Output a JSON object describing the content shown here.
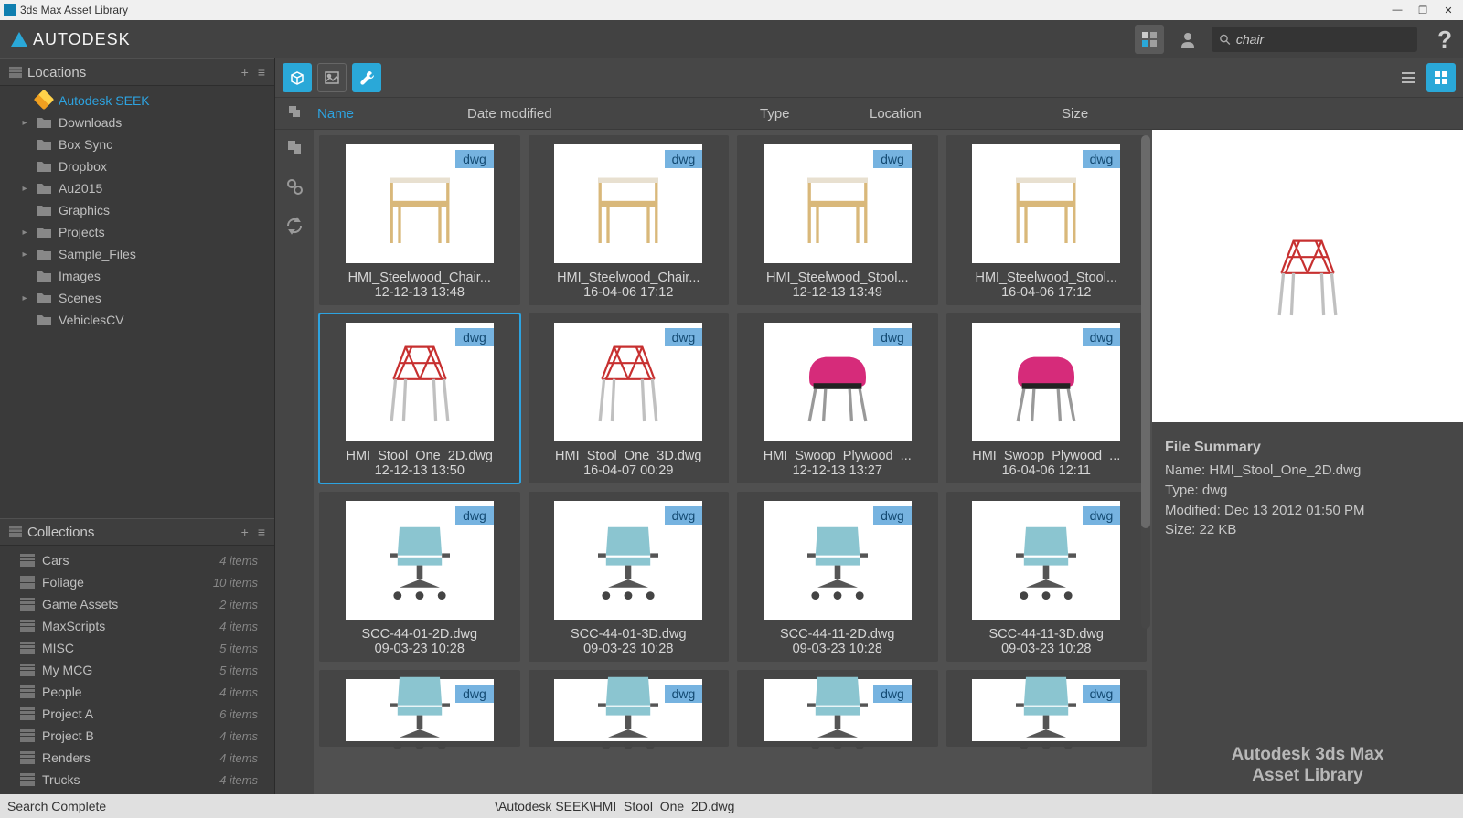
{
  "window": {
    "title": "3ds Max Asset Library"
  },
  "header": {
    "logo_text": "AUTODESK",
    "search_value": "chair"
  },
  "sidebar": {
    "locations": {
      "title": "Locations",
      "add_label": "+",
      "items": [
        {
          "label": "Autodesk SEEK",
          "expand": "",
          "icon": "seek",
          "active": true
        },
        {
          "label": "Downloads",
          "expand": "▸",
          "icon": "folder"
        },
        {
          "label": "Box Sync",
          "expand": "",
          "icon": "folder"
        },
        {
          "label": "Dropbox",
          "expand": "",
          "icon": "folder"
        },
        {
          "label": "Au2015",
          "expand": "▸",
          "icon": "folder"
        },
        {
          "label": "Graphics",
          "expand": "",
          "icon": "folder"
        },
        {
          "label": "Projects",
          "expand": "▸",
          "icon": "folder"
        },
        {
          "label": "Sample_Files",
          "expand": "▸",
          "icon": "folder"
        },
        {
          "label": "Images",
          "expand": "",
          "icon": "folder"
        },
        {
          "label": "Scenes",
          "expand": "▸",
          "icon": "folder"
        },
        {
          "label": "VehiclesCV",
          "expand": "",
          "icon": "folder"
        }
      ]
    },
    "collections": {
      "title": "Collections",
      "items": [
        {
          "label": "Cars",
          "count": "4 items"
        },
        {
          "label": "Foliage",
          "count": "10 items"
        },
        {
          "label": "Game Assets",
          "count": "2 items"
        },
        {
          "label": "MaxScripts",
          "count": "4 items"
        },
        {
          "label": "MISC",
          "count": "5 items"
        },
        {
          "label": "My MCG",
          "count": "5 items"
        },
        {
          "label": "People",
          "count": "4 items"
        },
        {
          "label": "Project A",
          "count": "6 items"
        },
        {
          "label": "Project B",
          "count": "4 items"
        },
        {
          "label": "Renders",
          "count": "4 items"
        },
        {
          "label": "Trucks",
          "count": "4 items"
        }
      ]
    }
  },
  "columns": {
    "name": "Name",
    "date": "Date modified",
    "type": "Type",
    "location": "Location",
    "size": "Size"
  },
  "assets": [
    {
      "name": "HMI_Steelwood_Chair...",
      "date": "12-12-13 13:48",
      "badge": "dwg",
      "style": "wood"
    },
    {
      "name": "HMI_Steelwood_Chair...",
      "date": "16-04-06 17:12",
      "badge": "dwg",
      "style": "wood"
    },
    {
      "name": "HMI_Steelwood_Stool...",
      "date": "12-12-13 13:49",
      "badge": "dwg",
      "style": "wood"
    },
    {
      "name": "HMI_Steelwood_Stool...",
      "date": "16-04-06 17:12",
      "badge": "dwg",
      "style": "wood"
    },
    {
      "name": "HMI_Stool_One_2D.dwg",
      "date": "12-12-13 13:50",
      "badge": "dwg",
      "style": "wire",
      "selected": true
    },
    {
      "name": "HMI_Stool_One_3D.dwg",
      "date": "16-04-07 00:29",
      "badge": "dwg",
      "style": "wire"
    },
    {
      "name": "HMI_Swoop_Plywood_...",
      "date": "12-12-13 13:27",
      "badge": "dwg",
      "style": "pink"
    },
    {
      "name": "HMI_Swoop_Plywood_...",
      "date": "16-04-06 12:11",
      "badge": "dwg",
      "style": "pink"
    },
    {
      "name": "SCC-44-01-2D.dwg",
      "date": "09-03-23 10:28",
      "badge": "dwg",
      "style": "office"
    },
    {
      "name": "SCC-44-01-3D.dwg",
      "date": "09-03-23 10:28",
      "badge": "dwg",
      "style": "office"
    },
    {
      "name": "SCC-44-11-2D.dwg",
      "date": "09-03-23 10:28",
      "badge": "dwg",
      "style": "office"
    },
    {
      "name": "SCC-44-11-3D.dwg",
      "date": "09-03-23 10:28",
      "badge": "dwg",
      "style": "office"
    },
    {
      "name": "",
      "date": "",
      "badge": "dwg",
      "style": "office",
      "short": true
    },
    {
      "name": "",
      "date": "",
      "badge": "dwg",
      "style": "office",
      "short": true
    },
    {
      "name": "",
      "date": "",
      "badge": "dwg",
      "style": "office",
      "short": true
    },
    {
      "name": "",
      "date": "",
      "badge": "dwg",
      "style": "office",
      "short": true
    }
  ],
  "detail": {
    "summary_title": "File Summary",
    "name_label": "Name: ",
    "name_value": "HMI_Stool_One_2D.dwg",
    "type_label": "Type: ",
    "type_value": "dwg",
    "modified_label": "Modified: ",
    "modified_value": "Dec 13 2012 01:50 PM",
    "size_label": "Size: ",
    "size_value": "22 KB",
    "brand_line1": "Autodesk 3ds Max",
    "brand_line2": "Asset Library"
  },
  "status": {
    "left": "Search Complete",
    "center": "\\Autodesk SEEK\\HMI_Stool_One_2D.dwg"
  }
}
